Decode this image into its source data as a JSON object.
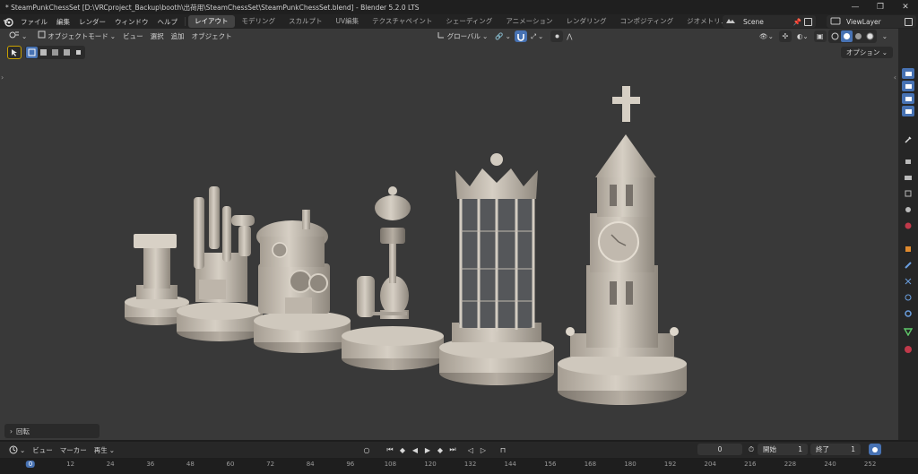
{
  "window": {
    "title": "* SteamPunkChessSet [D:\\VRCproject_Backup\\booth\\出荷用\\SteamChessSet\\SteamPunkChessSet.blend] - Blender 5.2.0 LTS"
  },
  "menus": [
    "ファイル",
    "編集",
    "レンダー",
    "ウィンドウ",
    "ヘルプ"
  ],
  "workspaces": [
    "レイアウト",
    "モデリング",
    "スカルプト",
    "UV編集",
    "テクスチャペイント",
    "シェーディング",
    "アニメーション",
    "レンダリング",
    "コンポジティング",
    "ジオメトリノ"
  ],
  "active_workspace": "レイアウト",
  "scene": {
    "name": "Scene",
    "view_layer": "ViewLayer"
  },
  "viewport_header": {
    "mode": "オブジェクトモード",
    "menus": [
      "ビュー",
      "選択",
      "追加",
      "オブジェクト"
    ],
    "transform_orientation": "グローバル",
    "options": "オプション"
  },
  "last_operator": "回転",
  "timeline": {
    "menus": [
      "ビュー",
      "マーカー"
    ],
    "playback": "再生",
    "current_frame": "0",
    "start_label": "開始",
    "start": "1",
    "end_label": "終了",
    "end": "1",
    "ruler": [
      "0",
      "12",
      "24",
      "36",
      "48",
      "60",
      "72",
      "84",
      "96",
      "108",
      "120",
      "132",
      "144",
      "156",
      "168",
      "180",
      "192",
      "204",
      "216",
      "228",
      "240",
      "252"
    ]
  },
  "colors": {
    "accent": "#4772b3",
    "viewport_bg": "#393939",
    "model": "#c5bdb2"
  },
  "icons": {
    "blender_logo": "blender-logo-icon",
    "select_box": "select-box-icon",
    "snap": "magnet-icon",
    "proportional": "proportional-edit-icon",
    "shading_solid": "solid-shading-icon"
  }
}
